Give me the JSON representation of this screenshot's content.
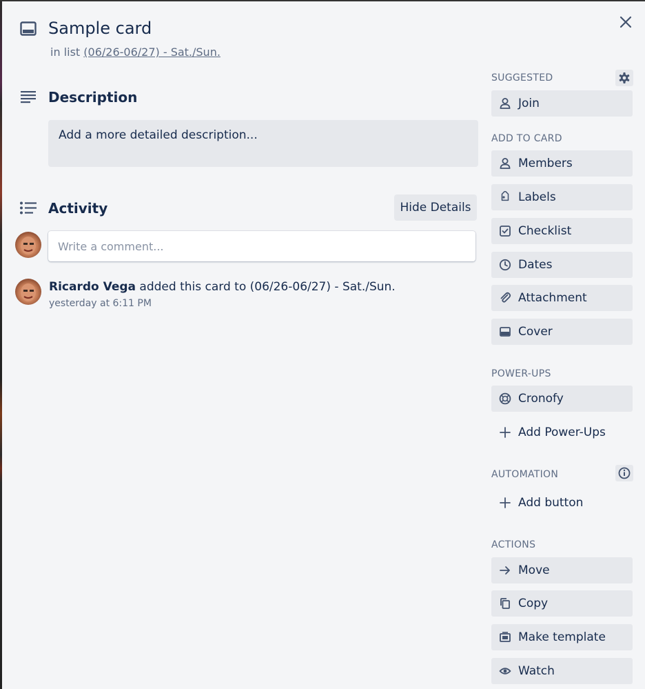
{
  "card": {
    "title": "Sample card",
    "in_list_prefix": "in list",
    "list_name": "(06/26-06/27) - Sat./Sun."
  },
  "description": {
    "title": "Description",
    "placeholder": "Add a more detailed description..."
  },
  "activity": {
    "title": "Activity",
    "hide_details_label": "Hide Details",
    "comment_placeholder": "Write a comment...",
    "entries": [
      {
        "user": "Ricardo Vega",
        "action": "added this card to (06/26-06/27) - Sat./Sun.",
        "time": "yesterday at 6:11 PM"
      }
    ]
  },
  "sidebar": {
    "suggested": {
      "header": "SUGGESTED",
      "items": [
        {
          "label": "Join",
          "icon": "person-icon"
        }
      ]
    },
    "add_to_card": {
      "header": "ADD TO CARD",
      "items": [
        {
          "label": "Members",
          "icon": "person-icon"
        },
        {
          "label": "Labels",
          "icon": "tag-icon"
        },
        {
          "label": "Checklist",
          "icon": "checkbox-icon"
        },
        {
          "label": "Dates",
          "icon": "clock-icon"
        },
        {
          "label": "Attachment",
          "icon": "paperclip-icon"
        },
        {
          "label": "Cover",
          "icon": "cover-icon"
        }
      ]
    },
    "power_ups": {
      "header": "POWER-UPS",
      "items": [
        {
          "label": "Cronofy",
          "icon": "cronofy-icon"
        },
        {
          "label": "Add Power-Ups",
          "icon": "plus-icon"
        }
      ]
    },
    "automation": {
      "header": "AUTOMATION",
      "items": [
        {
          "label": "Add button",
          "icon": "plus-icon"
        }
      ]
    },
    "actions": {
      "header": "ACTIONS",
      "items": [
        {
          "label": "Move",
          "icon": "arrow-right-icon"
        },
        {
          "label": "Copy",
          "icon": "copy-icon"
        },
        {
          "label": "Make template",
          "icon": "template-icon"
        },
        {
          "label": "Watch",
          "icon": "eye-icon"
        }
      ]
    }
  },
  "colors": {
    "background": "#f4f5f7",
    "button": "#e6e8ec",
    "text": "#172b4d",
    "muted": "#5e6c84"
  }
}
